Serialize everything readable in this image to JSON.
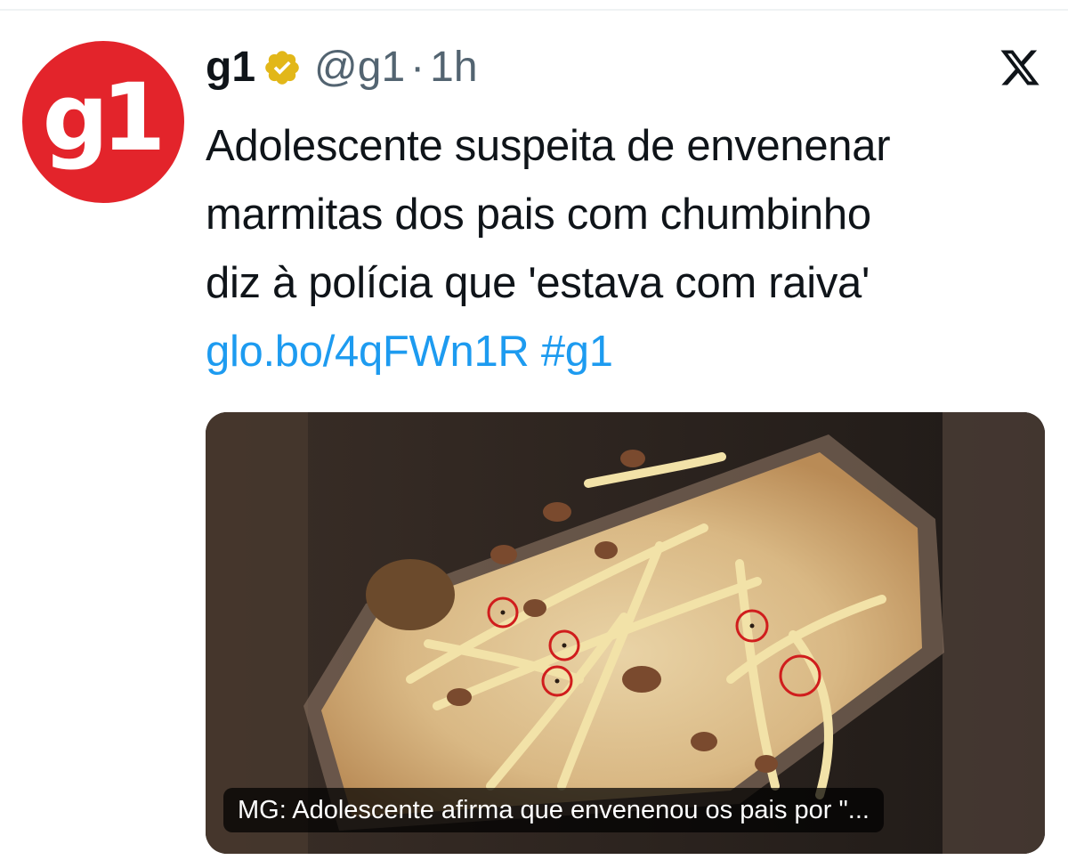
{
  "tweet": {
    "author": {
      "display_name": "g1",
      "avatar_text": "g1",
      "verified": true,
      "verified_badge_icon": "verified-badge-gold",
      "handle": "@g1",
      "separator": "·",
      "time": "1h"
    },
    "text_lines": [
      "Adolescente suspeita de envenenar",
      "marmitas dos pais com chumbinho",
      "diz à polícia que 'estava com raiva'"
    ],
    "links": {
      "short_url": "glo.bo/4qFWn1R",
      "hashtag": "#g1"
    },
    "media": {
      "caption": "MG: Adolescente afirma que envenenou os pais por \"..."
    }
  },
  "platform_icon": "x-logo-icon",
  "colors": {
    "brand_red": "#e3242b",
    "link_blue": "#1d9bf0",
    "verified_gold": "#e2b719",
    "secondary_text": "#536471",
    "primary_text": "#0f1419"
  }
}
